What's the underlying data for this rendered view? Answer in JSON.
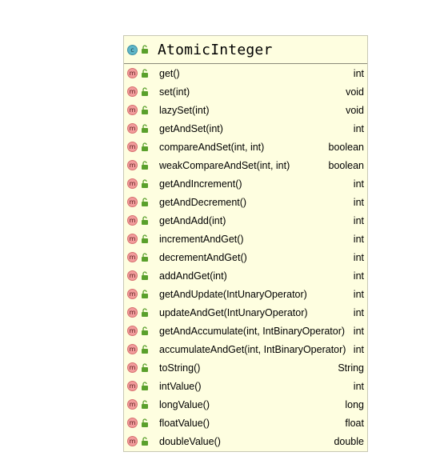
{
  "class": {
    "kind_letter": "c",
    "name": "AtomicInteger"
  },
  "method_badge_letter": "m",
  "methods": [
    {
      "name": "get()",
      "type": "int"
    },
    {
      "name": "set(int)",
      "type": "void"
    },
    {
      "name": "lazySet(int)",
      "type": "void"
    },
    {
      "name": "getAndSet(int)",
      "type": "int"
    },
    {
      "name": "compareAndSet(int, int)",
      "type": "boolean"
    },
    {
      "name": "weakCompareAndSet(int, int)",
      "type": "boolean"
    },
    {
      "name": "getAndIncrement()",
      "type": "int"
    },
    {
      "name": "getAndDecrement()",
      "type": "int"
    },
    {
      "name": "getAndAdd(int)",
      "type": "int"
    },
    {
      "name": "incrementAndGet()",
      "type": "int"
    },
    {
      "name": "decrementAndGet()",
      "type": "int"
    },
    {
      "name": "addAndGet(int)",
      "type": "int"
    },
    {
      "name": "getAndUpdate(IntUnaryOperator)",
      "type": "int"
    },
    {
      "name": "updateAndGet(IntUnaryOperator)",
      "type": "int"
    },
    {
      "name": "getAndAccumulate(int, IntBinaryOperator)",
      "type": "int"
    },
    {
      "name": "accumulateAndGet(int, IntBinaryOperator)",
      "type": "int"
    },
    {
      "name": "toString()",
      "type": "String"
    },
    {
      "name": "intValue()",
      "type": "int"
    },
    {
      "name": "longValue()",
      "type": "long"
    },
    {
      "name": "floatValue()",
      "type": "float"
    },
    {
      "name": "doubleValue()",
      "type": "double"
    }
  ],
  "colors": {
    "box_background": "#fefee0",
    "class_badge": "#5fb6c8",
    "method_badge": "#f29c9c",
    "public_lock": "#5aa02c"
  },
  "icons": {
    "class_kind": "class-icon",
    "method_kind": "method-icon",
    "visibility": "public-lock-icon"
  }
}
